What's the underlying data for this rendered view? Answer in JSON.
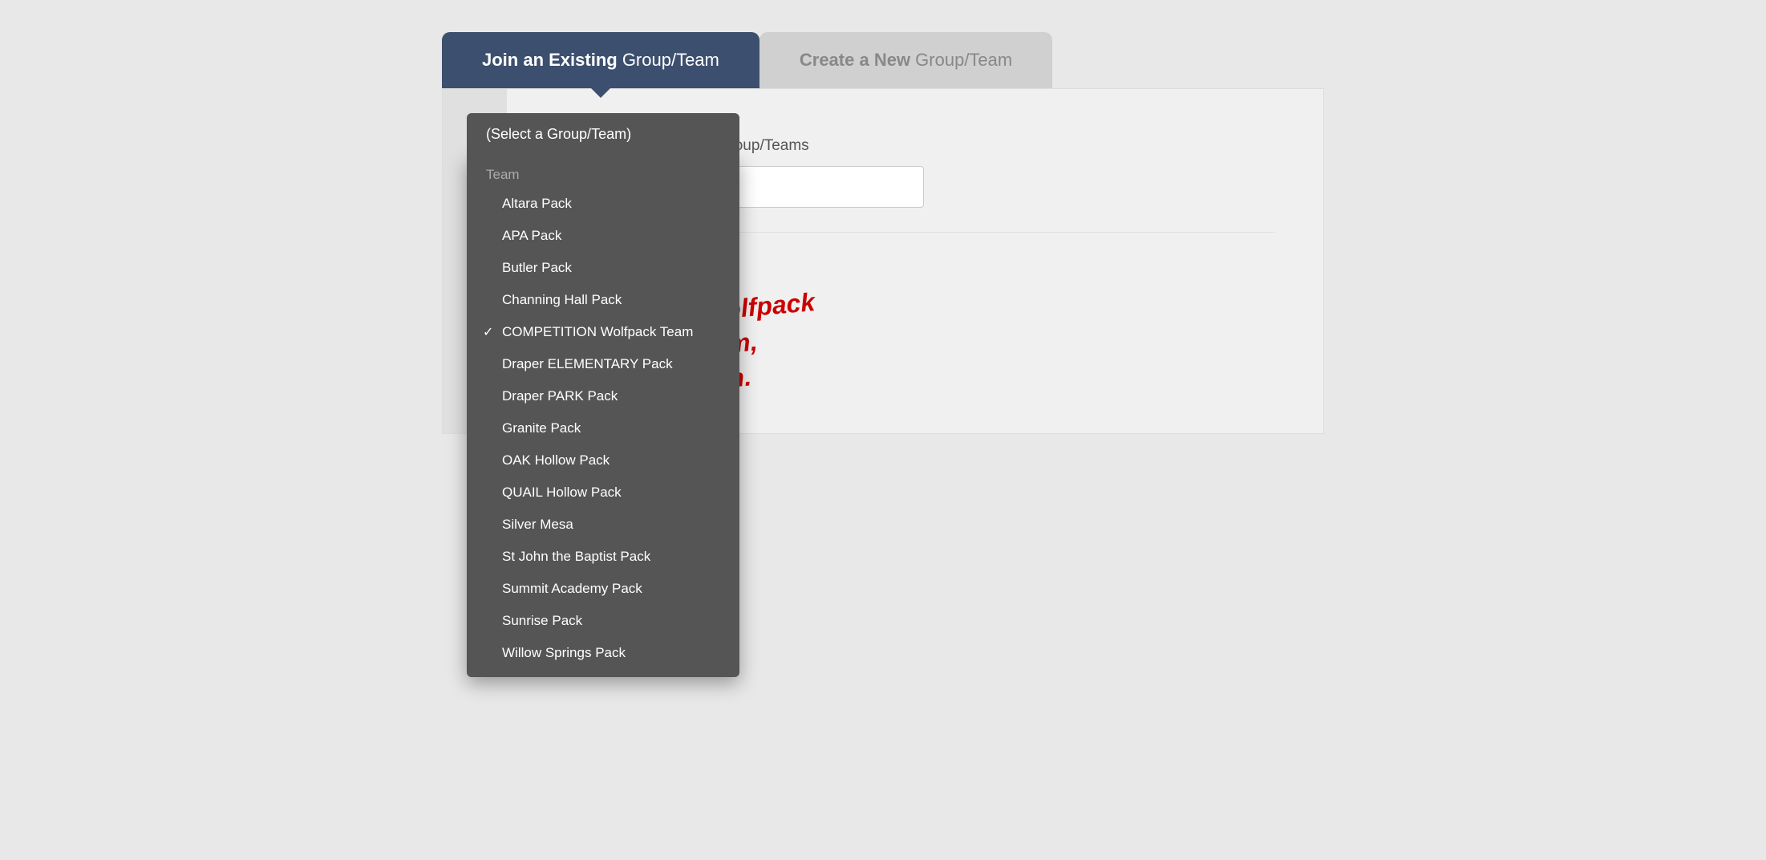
{
  "tabs": {
    "join": {
      "label_bold": "Join an Existing",
      "label_normal": " Group/Team",
      "active": true
    },
    "create": {
      "label_bold": "Create a New",
      "label_normal": " Group/Team",
      "active": false
    }
  },
  "search": {
    "label": "Search for existing Group/Teams",
    "placeholder": ""
  },
  "wolfpack_message": "If you're on a Wolfpack\nElementary Team,\nselect your team.",
  "dropdown": {
    "trigger_label": "(Select a Group/Team)",
    "group_label": "Team",
    "items": [
      {
        "label": "Altara Pack",
        "selected": false
      },
      {
        "label": "APA Pack",
        "selected": false
      },
      {
        "label": "Butler Pack",
        "selected": false
      },
      {
        "label": "Channing Hall Pack",
        "selected": false
      },
      {
        "label": "COMPETITION Wolfpack Team",
        "selected": true
      },
      {
        "label": "Draper ELEMENTARY Pack",
        "selected": false
      },
      {
        "label": "Draper PARK Pack",
        "selected": false
      },
      {
        "label": "Granite Pack",
        "selected": false
      },
      {
        "label": "OAK Hollow Pack",
        "selected": false
      },
      {
        "label": "QUAIL Hollow Pack",
        "selected": false
      },
      {
        "label": "Silver Mesa",
        "selected": false
      },
      {
        "label": "St John the Baptist Pack",
        "selected": false
      },
      {
        "label": "Summit Academy Pack",
        "selected": false
      },
      {
        "label": "Sunrise Pack",
        "selected": false
      },
      {
        "label": "Willow Springs Pack",
        "selected": false
      }
    ]
  }
}
